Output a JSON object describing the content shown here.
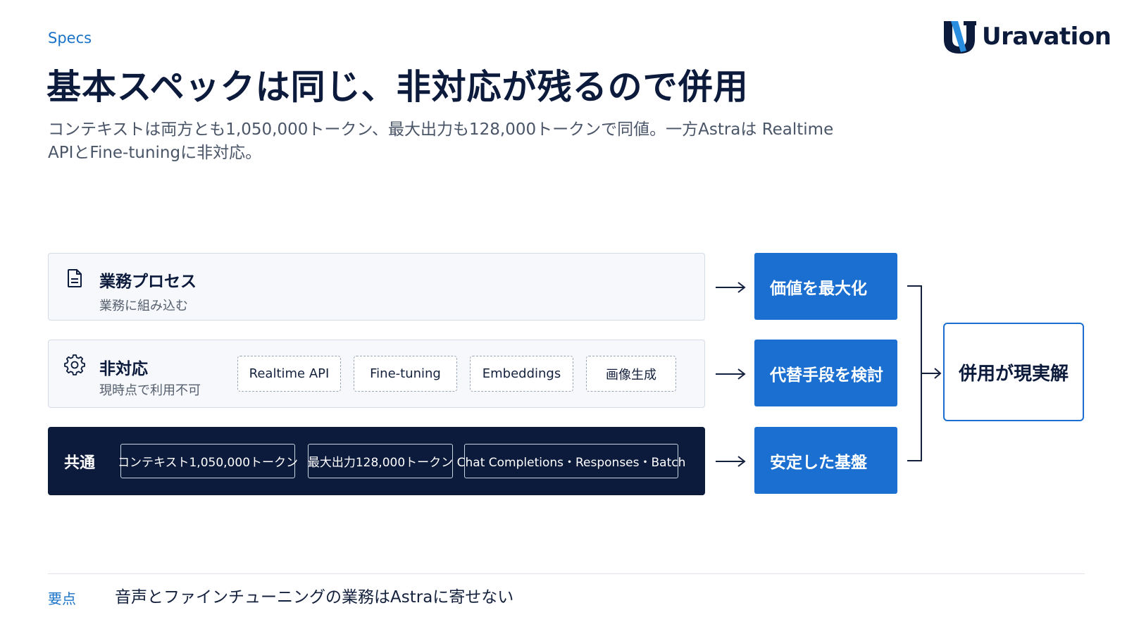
{
  "header": {
    "eyebrow": "Specs",
    "title": "基本スペックは同じ、非対応が残るので併用",
    "subtitle": "コンテキストは両方とも1,050,000トークン、最大出力も128,000トークンで同値。一方Astraは Realtime APIとFine-tuningに非対応。"
  },
  "logo": {
    "text": "Uravation",
    "icon": "uravation-logo-icon",
    "colors": {
      "navy": "#0c1a3c",
      "blue": "#2a8ee0"
    }
  },
  "rows": {
    "process": {
      "title": "業務プロセス",
      "subtitle": "業務に組み込む",
      "icon": "document-icon"
    },
    "unsupported": {
      "title": "非対応",
      "subtitle": "現時点で利用不可",
      "icon": "gear-icon",
      "chips": [
        "Realtime API",
        "Fine-tuning",
        "Embeddings",
        "画像生成"
      ]
    },
    "common": {
      "title": "共通",
      "chips": [
        "コンテキスト1,050,000トークン",
        "最大出力128,000トークン",
        "Chat Completions・Responses・Batch"
      ]
    }
  },
  "outcomes": [
    "価値を最大化",
    "代替手段を検討",
    "安定した基盤"
  ],
  "conclusion": "併用が現実解",
  "footer": {
    "label": "要点",
    "text": "音声とファインチューニングの業務はAstraに寄せない"
  },
  "colors": {
    "accent": "#1a6fd0",
    "navy": "#0c1a3c",
    "eyebrow": "#1a73c8"
  }
}
